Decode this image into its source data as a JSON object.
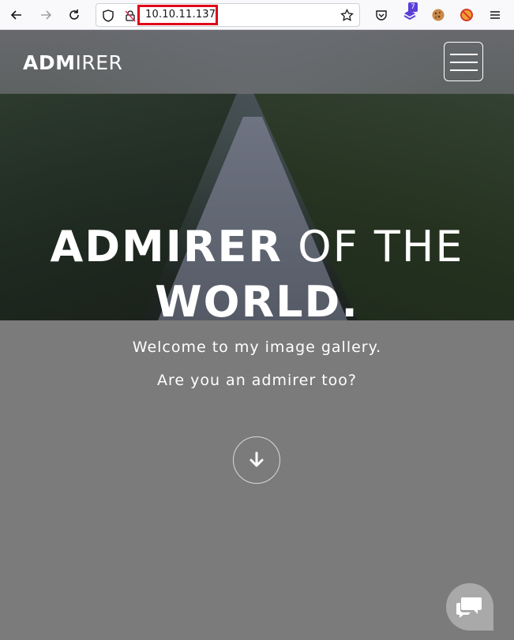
{
  "browser": {
    "url": "10.10.11.137",
    "extension_badge": "7",
    "icons": [
      "back-icon",
      "forward-icon",
      "reload-icon",
      "shield-icon",
      "lock-insecure-icon",
      "star-icon",
      "pocket-icon",
      "extension-icon",
      "cookie-icon",
      "blocked-icon",
      "hamburger-icon"
    ]
  },
  "site": {
    "logo_bold": "ADM",
    "logo_light": "IRER",
    "hero_title_bold_1": "ADMIRER",
    "hero_title_light": "OF THE",
    "hero_title_bold_2": "WORLD.",
    "subtitle_1": "Welcome to my image gallery.",
    "subtitle_2": "Are you an admirer too?",
    "scroll_icon": "arrow-down-icon",
    "chat_icon": "chat-icon"
  },
  "colors": {
    "url_highlight": "#e0001b",
    "badge": "#5b3fd6",
    "page_bg": "#7b7b7b"
  }
}
